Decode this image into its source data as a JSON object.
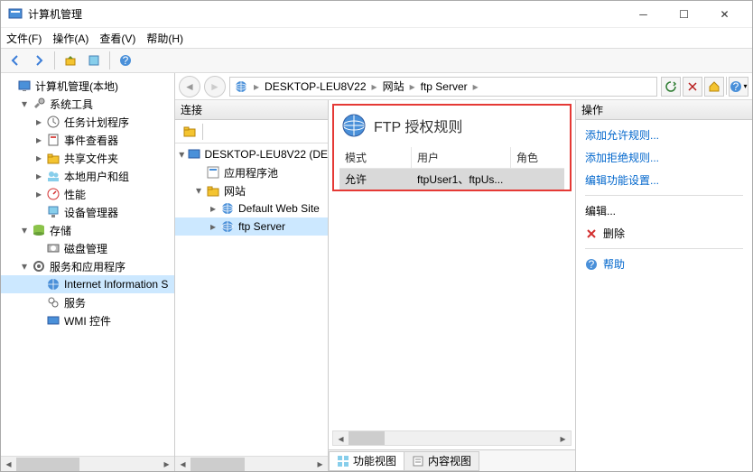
{
  "window": {
    "title": "计算机管理"
  },
  "menu": {
    "file": "文件(F)",
    "action": "操作(A)",
    "view": "查看(V)",
    "help": "帮助(H)"
  },
  "leftTree": [
    {
      "indent": 0,
      "exp": "",
      "icon": "mgmt-icon",
      "label": "计算机管理(本地)"
    },
    {
      "indent": 1,
      "exp": "▾",
      "icon": "tools-icon",
      "label": "系统工具"
    },
    {
      "indent": 2,
      "exp": "▸",
      "icon": "task-icon",
      "label": "任务计划程序"
    },
    {
      "indent": 2,
      "exp": "▸",
      "icon": "event-icon",
      "label": "事件查看器"
    },
    {
      "indent": 2,
      "exp": "▸",
      "icon": "share-icon",
      "label": "共享文件夹"
    },
    {
      "indent": 2,
      "exp": "▸",
      "icon": "users-icon",
      "label": "本地用户和组"
    },
    {
      "indent": 2,
      "exp": "▸",
      "icon": "perf-icon",
      "label": "性能"
    },
    {
      "indent": 2,
      "exp": "",
      "icon": "device-icon",
      "label": "设备管理器"
    },
    {
      "indent": 1,
      "exp": "▾",
      "icon": "storage-icon",
      "label": "存储"
    },
    {
      "indent": 2,
      "exp": "",
      "icon": "disk-icon",
      "label": "磁盘管理"
    },
    {
      "indent": 1,
      "exp": "▾",
      "icon": "services-icon",
      "label": "服务和应用程序"
    },
    {
      "indent": 2,
      "exp": "",
      "icon": "iis-icon",
      "label": "Internet Information S",
      "selected": true
    },
    {
      "indent": 2,
      "exp": "",
      "icon": "svc-icon",
      "label": "服务"
    },
    {
      "indent": 2,
      "exp": "",
      "icon": "wmi-icon",
      "label": "WMI 控件"
    }
  ],
  "breadcrumbs": {
    "host": "DESKTOP-LEU8V22",
    "sites": "网站",
    "server": "ftp Server"
  },
  "panes": {
    "conn": "连接",
    "actions": "操作"
  },
  "connTree": [
    {
      "indent": 0,
      "exp": "▾",
      "icon": "host-icon",
      "label": "DESKTOP-LEU8V22 (DE"
    },
    {
      "indent": 1,
      "exp": "",
      "icon": "pool-icon",
      "label": "应用程序池"
    },
    {
      "indent": 1,
      "exp": "▾",
      "icon": "sites-icon",
      "label": "网站"
    },
    {
      "indent": 2,
      "exp": "▸",
      "icon": "globe-icon",
      "label": "Default Web Site"
    },
    {
      "indent": 2,
      "exp": "▸",
      "icon": "globe-icon",
      "label": "ftp Server",
      "selected": true
    }
  ],
  "center": {
    "title": "FTP 授权规则",
    "cols": {
      "mode": "模式",
      "user": "用户",
      "role": "角色"
    },
    "row": {
      "mode": "允许",
      "user": "ftpUser1、ftpUs...",
      "role": ""
    }
  },
  "tabs": {
    "features": "功能视图",
    "content": "内容视图"
  },
  "actions": {
    "addAllow": "添加允许规则...",
    "addDeny": "添加拒绝规则...",
    "editFeature": "编辑功能设置...",
    "edit": "编辑...",
    "delete": "删除",
    "help": "帮助"
  }
}
